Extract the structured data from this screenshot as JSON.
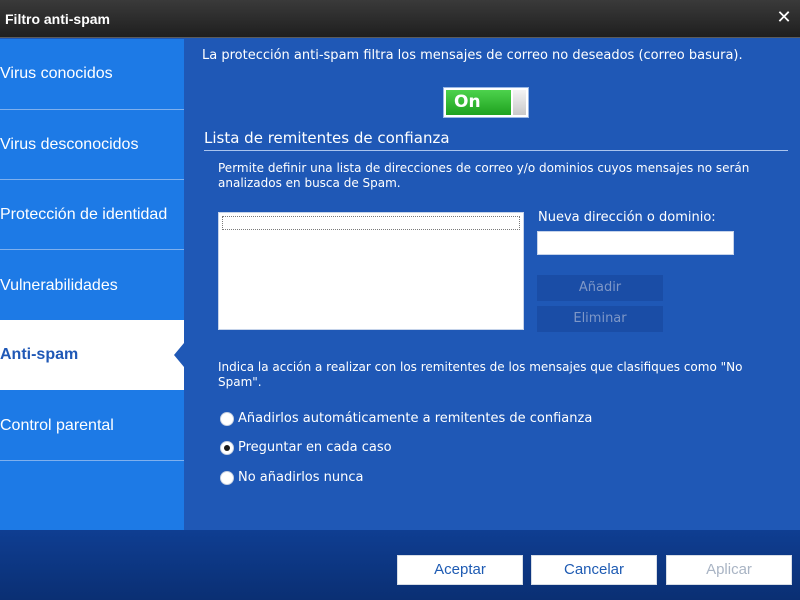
{
  "window": {
    "title": "Filtro anti-spam",
    "close_glyph": "✕"
  },
  "sidebar": {
    "items": [
      {
        "label": "Virus conocidos"
      },
      {
        "label": "Virus desconocidos"
      },
      {
        "label": "Protección de identidad"
      },
      {
        "label": "Vulnerabilidades"
      },
      {
        "label": "Anti-spam",
        "active": true
      },
      {
        "label": "Control parental"
      }
    ]
  },
  "main": {
    "description": "La protección anti-spam filtra los mensajes de correo no deseados (correo basura).",
    "toggle": {
      "label": "On",
      "state": "on"
    },
    "trusted": {
      "title": "Lista de remitentes de confianza",
      "description": "Permite definir una lista de direcciones de correo y/o dominios cuyos mensajes no serán analizados en busca de Spam.",
      "input_label": "Nueva dirección o dominio:",
      "input_value": "",
      "add_label": "Añadir",
      "remove_label": "Eliminar"
    },
    "action": {
      "description": "Indica la acción a realizar con los remitentes de los mensajes que clasifiques como \"No Spam\".",
      "options": [
        {
          "label": "Añadirlos automáticamente a remitentes de confianza",
          "checked": false
        },
        {
          "label": "Preguntar en cada caso",
          "checked": true
        },
        {
          "label": "No añadirlos nunca",
          "checked": false
        }
      ]
    }
  },
  "footer": {
    "accept_label": "Aceptar",
    "cancel_label": "Cancelar",
    "apply_label": "Aplicar"
  },
  "colors": {
    "accent": "#1f58b6",
    "sidebar": "#1d7ae6",
    "toggle_on": "#2fb82f"
  }
}
